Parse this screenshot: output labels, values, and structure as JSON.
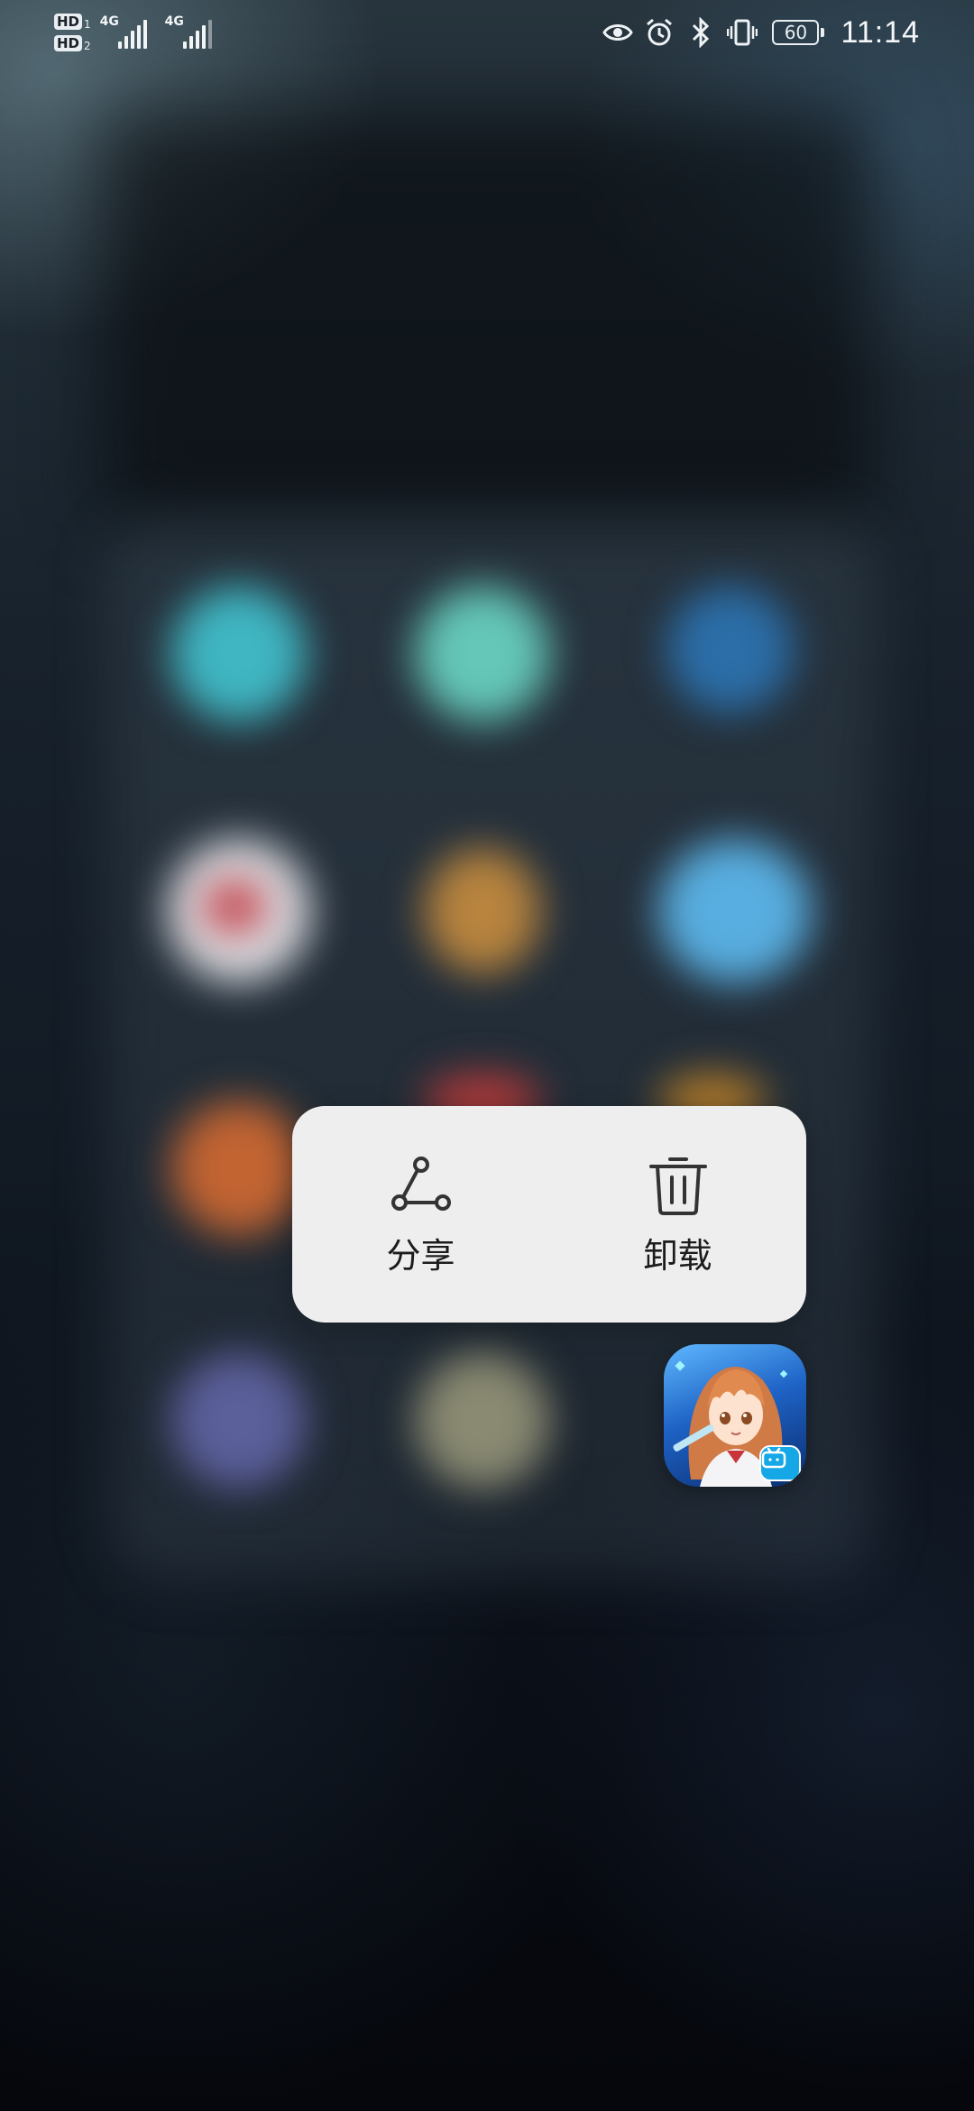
{
  "status_bar": {
    "sim1_label": "HD",
    "sim1_index": "1",
    "sim2_label": "HD",
    "sim2_index": "2",
    "network1": "4G",
    "network2": "4G",
    "battery_level": "60",
    "time": "11:14",
    "icons": [
      "eye-comfort-icon",
      "alarm-icon",
      "bluetooth-icon",
      "vibrate-icon",
      "battery-icon"
    ]
  },
  "context_menu": {
    "items": [
      {
        "label": "分享",
        "icon": "share-icon"
      },
      {
        "label": "卸载",
        "icon": "uninstall-trash-icon"
      }
    ]
  },
  "app_icon": {
    "name": "app-icon-anime-game",
    "badge_icon": "bilibili-tv-icon"
  },
  "colors": {
    "menu_background": "#eeeeee",
    "menu_text": "#1c1c1c",
    "icon_stroke": "#333333"
  }
}
